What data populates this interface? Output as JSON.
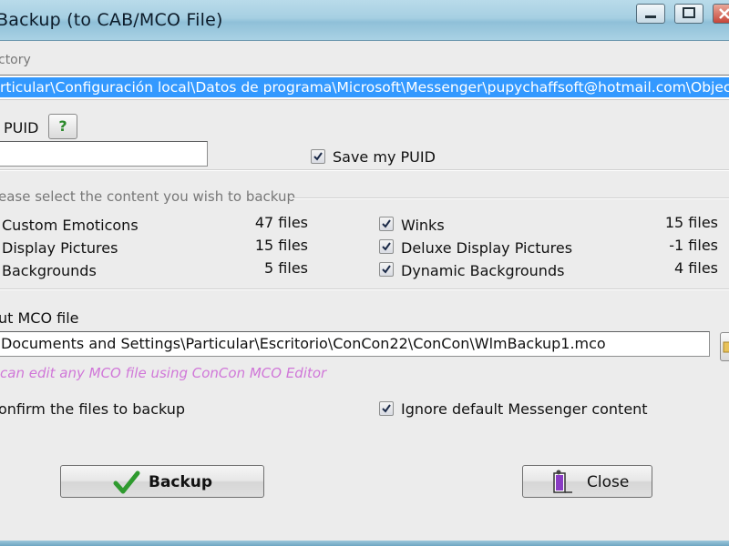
{
  "window": {
    "title": "Backup (to CAB/MCO File)",
    "controls": {
      "minimize": "minimize",
      "maximize": "maximize",
      "close": "close"
    }
  },
  "directory": {
    "label": "ctory",
    "value": "rticular\\Configuración local\\Datos de programa\\Microsoft\\Messenger\\pupychaffsoft@hotmail.com\\ObjectStore"
  },
  "puid": {
    "label": "PUID",
    "help_label": "?",
    "value": "",
    "save_label": "Save my PUID",
    "save_checked": true
  },
  "content": {
    "heading": "ease select the content you wish to backup",
    "left": [
      {
        "label": "Custom Emoticons",
        "count": "47 files"
      },
      {
        "label": "Display Pictures",
        "count": "15 files"
      },
      {
        "label": "Backgrounds",
        "count": "5 files"
      }
    ],
    "right": [
      {
        "label": "Winks",
        "count": "15 files",
        "checked": true
      },
      {
        "label": "Deluxe Display Pictures",
        "count": "-1 files",
        "checked": true
      },
      {
        "label": "Dynamic Backgrounds",
        "count": "4 files",
        "checked": true
      }
    ]
  },
  "output": {
    "label": "ut MCO file",
    "path": "Documents and Settings\\Particular\\Escritorio\\ConCon22\\ConCon\\WlmBackup1.mco",
    "hint": "can edit any MCO file using ConCon MCO Editor"
  },
  "options": {
    "confirm_label": "onfirm the files to backup",
    "ignore_label": "Ignore default Messenger content",
    "ignore_checked": true
  },
  "buttons": {
    "backup_label": "Backup",
    "close_label": "Close"
  },
  "colors": {
    "selection": "#3399ff",
    "hint": "#d077d8",
    "check_green": "#2e9a2e",
    "titlebar": "#a6cfe2"
  }
}
